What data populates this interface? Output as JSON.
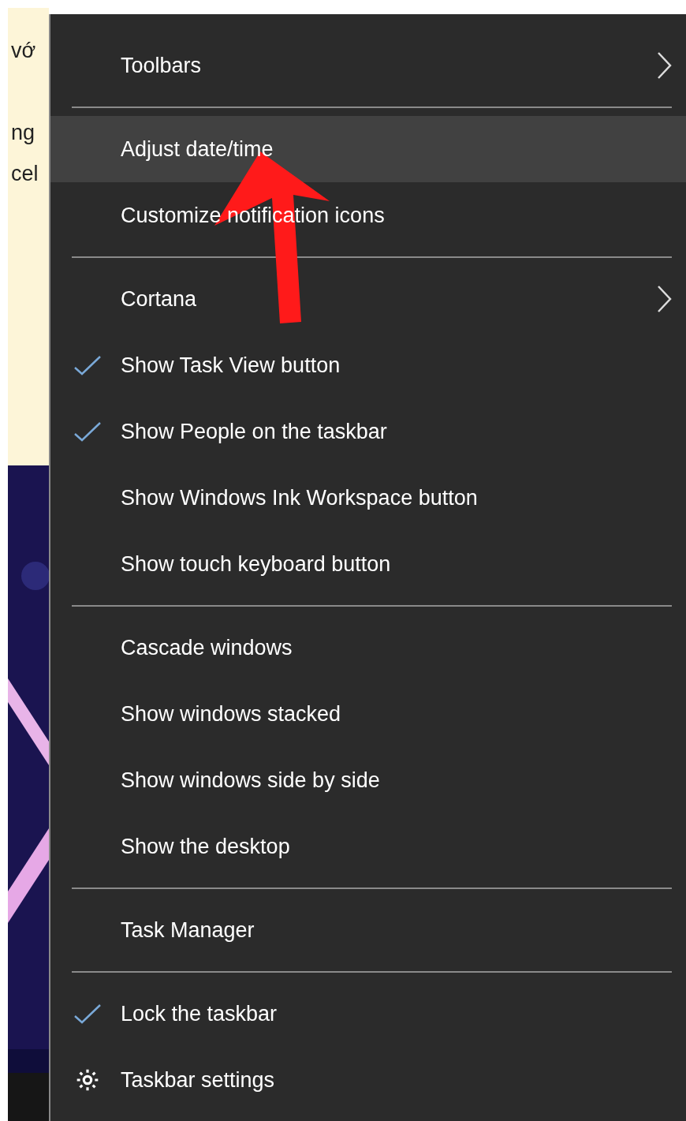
{
  "document": {
    "lines": [
      "vớ",
      "ng",
      "cel"
    ]
  },
  "menu": {
    "items": [
      {
        "kind": "item",
        "label": "Toolbars",
        "checked": false,
        "selected": false,
        "submenu": true
      },
      {
        "kind": "separator"
      },
      {
        "kind": "item",
        "label": "Adjust date/time",
        "checked": false,
        "selected": true,
        "submenu": false
      },
      {
        "kind": "item",
        "label": "Customize notification icons",
        "checked": false,
        "selected": false,
        "submenu": false
      },
      {
        "kind": "separator"
      },
      {
        "kind": "item",
        "label": "Cortana",
        "checked": false,
        "selected": false,
        "submenu": true
      },
      {
        "kind": "item",
        "label": "Show Task View button",
        "checked": true,
        "selected": false,
        "submenu": false
      },
      {
        "kind": "item",
        "label": "Show People on the taskbar",
        "checked": true,
        "selected": false,
        "submenu": false
      },
      {
        "kind": "item",
        "label": "Show Windows Ink Workspace button",
        "checked": false,
        "selected": false,
        "submenu": false
      },
      {
        "kind": "item",
        "label": "Show touch keyboard button",
        "checked": false,
        "selected": false,
        "submenu": false
      },
      {
        "kind": "separator"
      },
      {
        "kind": "item",
        "label": "Cascade windows",
        "checked": false,
        "selected": false,
        "submenu": false
      },
      {
        "kind": "item",
        "label": "Show windows stacked",
        "checked": false,
        "selected": false,
        "submenu": false
      },
      {
        "kind": "item",
        "label": "Show windows side by side",
        "checked": false,
        "selected": false,
        "submenu": false
      },
      {
        "kind": "item",
        "label": "Show the desktop",
        "checked": false,
        "selected": false,
        "submenu": false
      },
      {
        "kind": "separator"
      },
      {
        "kind": "item",
        "label": "Task Manager",
        "checked": false,
        "selected": false,
        "submenu": false
      },
      {
        "kind": "separator"
      },
      {
        "kind": "item",
        "label": "Lock the taskbar",
        "checked": true,
        "selected": false,
        "submenu": false
      },
      {
        "kind": "setting",
        "label": "Taskbar settings",
        "checked": false,
        "selected": false,
        "submenu": false
      }
    ]
  }
}
